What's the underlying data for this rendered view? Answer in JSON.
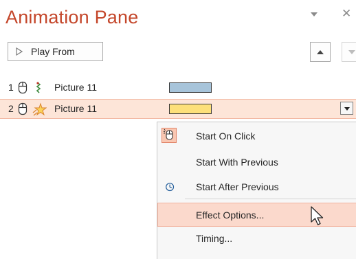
{
  "pane": {
    "title": "Animation Pane",
    "play_from_label": "Play From"
  },
  "animations": [
    {
      "order": "1",
      "trigger_icon": "mouse-click-icon",
      "effect_icon": "entrance-effect-icon",
      "name": "Picture 11",
      "bar_color": "#a7c4da"
    },
    {
      "order": "2",
      "trigger_icon": "mouse-click-icon",
      "effect_icon": "emphasis-star-icon",
      "name": "Picture 11",
      "bar_color": "#fde07a",
      "selected": true
    }
  ],
  "context_menu": {
    "items": [
      {
        "label": "Start On Click",
        "icon": "mouse-click-icon",
        "checked": true
      },
      {
        "label": "Start With Previous",
        "icon": ""
      },
      {
        "label": "Start After Previous",
        "icon": "clock-icon"
      },
      {
        "label": "Effect Options...",
        "icon": "",
        "highlighted": true
      },
      {
        "label": "Timing...",
        "icon": ""
      }
    ]
  },
  "colors": {
    "title": "#c4462a",
    "selected_row": "#fde5d8",
    "menu_highlight": "#fbd9cc",
    "bar1": "#a7c4da",
    "bar2": "#fde07a"
  }
}
